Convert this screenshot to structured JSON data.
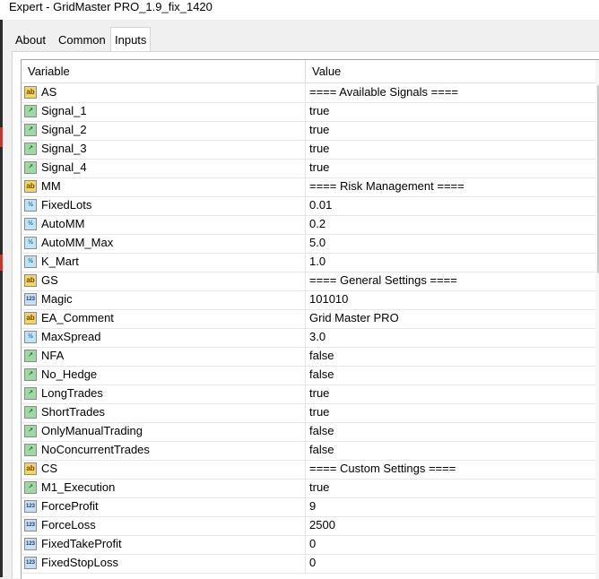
{
  "window": {
    "title": "Expert - GridMaster PRO_1.9_fix_1420"
  },
  "tabs": [
    {
      "label": "About"
    },
    {
      "label": "Common"
    },
    {
      "label": "Inputs",
      "active": true
    }
  ],
  "grid": {
    "columns": [
      "Variable",
      "Value"
    ],
    "rows": [
      {
        "icon": "ab-string-icon",
        "variable": "AS",
        "value": "==== Available Signals ===="
      },
      {
        "icon": "bool-icon",
        "variable": "Signal_1",
        "value": "true"
      },
      {
        "icon": "bool-icon",
        "variable": "Signal_2",
        "value": "true"
      },
      {
        "icon": "bool-icon",
        "variable": "Signal_3",
        "value": "true"
      },
      {
        "icon": "bool-icon",
        "variable": "Signal_4",
        "value": "true"
      },
      {
        "icon": "ab-string-icon",
        "variable": "MM",
        "value": "==== Risk Management ===="
      },
      {
        "icon": "double-icon",
        "variable": "FixedLots",
        "value": "0.01"
      },
      {
        "icon": "double-icon",
        "variable": "AutoMM",
        "value": "0.2"
      },
      {
        "icon": "double-icon",
        "variable": "AutoMM_Max",
        "value": "5.0"
      },
      {
        "icon": "double-icon",
        "variable": "K_Mart",
        "value": "1.0"
      },
      {
        "icon": "ab-string-icon",
        "variable": "GS",
        "value": "==== General Settings ===="
      },
      {
        "icon": "int-icon",
        "variable": "Magic",
        "value": "101010"
      },
      {
        "icon": "ab-string-icon",
        "variable": "EA_Comment",
        "value": "Grid Master PRO"
      },
      {
        "icon": "double-icon",
        "variable": "MaxSpread",
        "value": "3.0"
      },
      {
        "icon": "bool-icon",
        "variable": "NFA",
        "value": "false"
      },
      {
        "icon": "bool-icon",
        "variable": "No_Hedge",
        "value": "false"
      },
      {
        "icon": "bool-icon",
        "variable": "LongTrades",
        "value": "true"
      },
      {
        "icon": "bool-icon",
        "variable": "ShortTrades",
        "value": "true"
      },
      {
        "icon": "bool-icon",
        "variable": "OnlyManualTrading",
        "value": "false"
      },
      {
        "icon": "bool-icon",
        "variable": "NoConcurrentTrades",
        "value": "false"
      },
      {
        "icon": "ab-string-icon",
        "variable": "CS",
        "value": "==== Custom Settings ===="
      },
      {
        "icon": "bool-icon",
        "variable": "M1_Execution",
        "value": "true"
      },
      {
        "icon": "int-icon",
        "variable": "ForceProfit",
        "value": "9"
      },
      {
        "icon": "int-icon",
        "variable": "ForceLoss",
        "value": "2500"
      },
      {
        "icon": "int-icon",
        "variable": "FixedTakeProfit",
        "value": "0"
      },
      {
        "icon": "int-icon",
        "variable": "FixedStopLoss",
        "value": "0"
      }
    ]
  }
}
